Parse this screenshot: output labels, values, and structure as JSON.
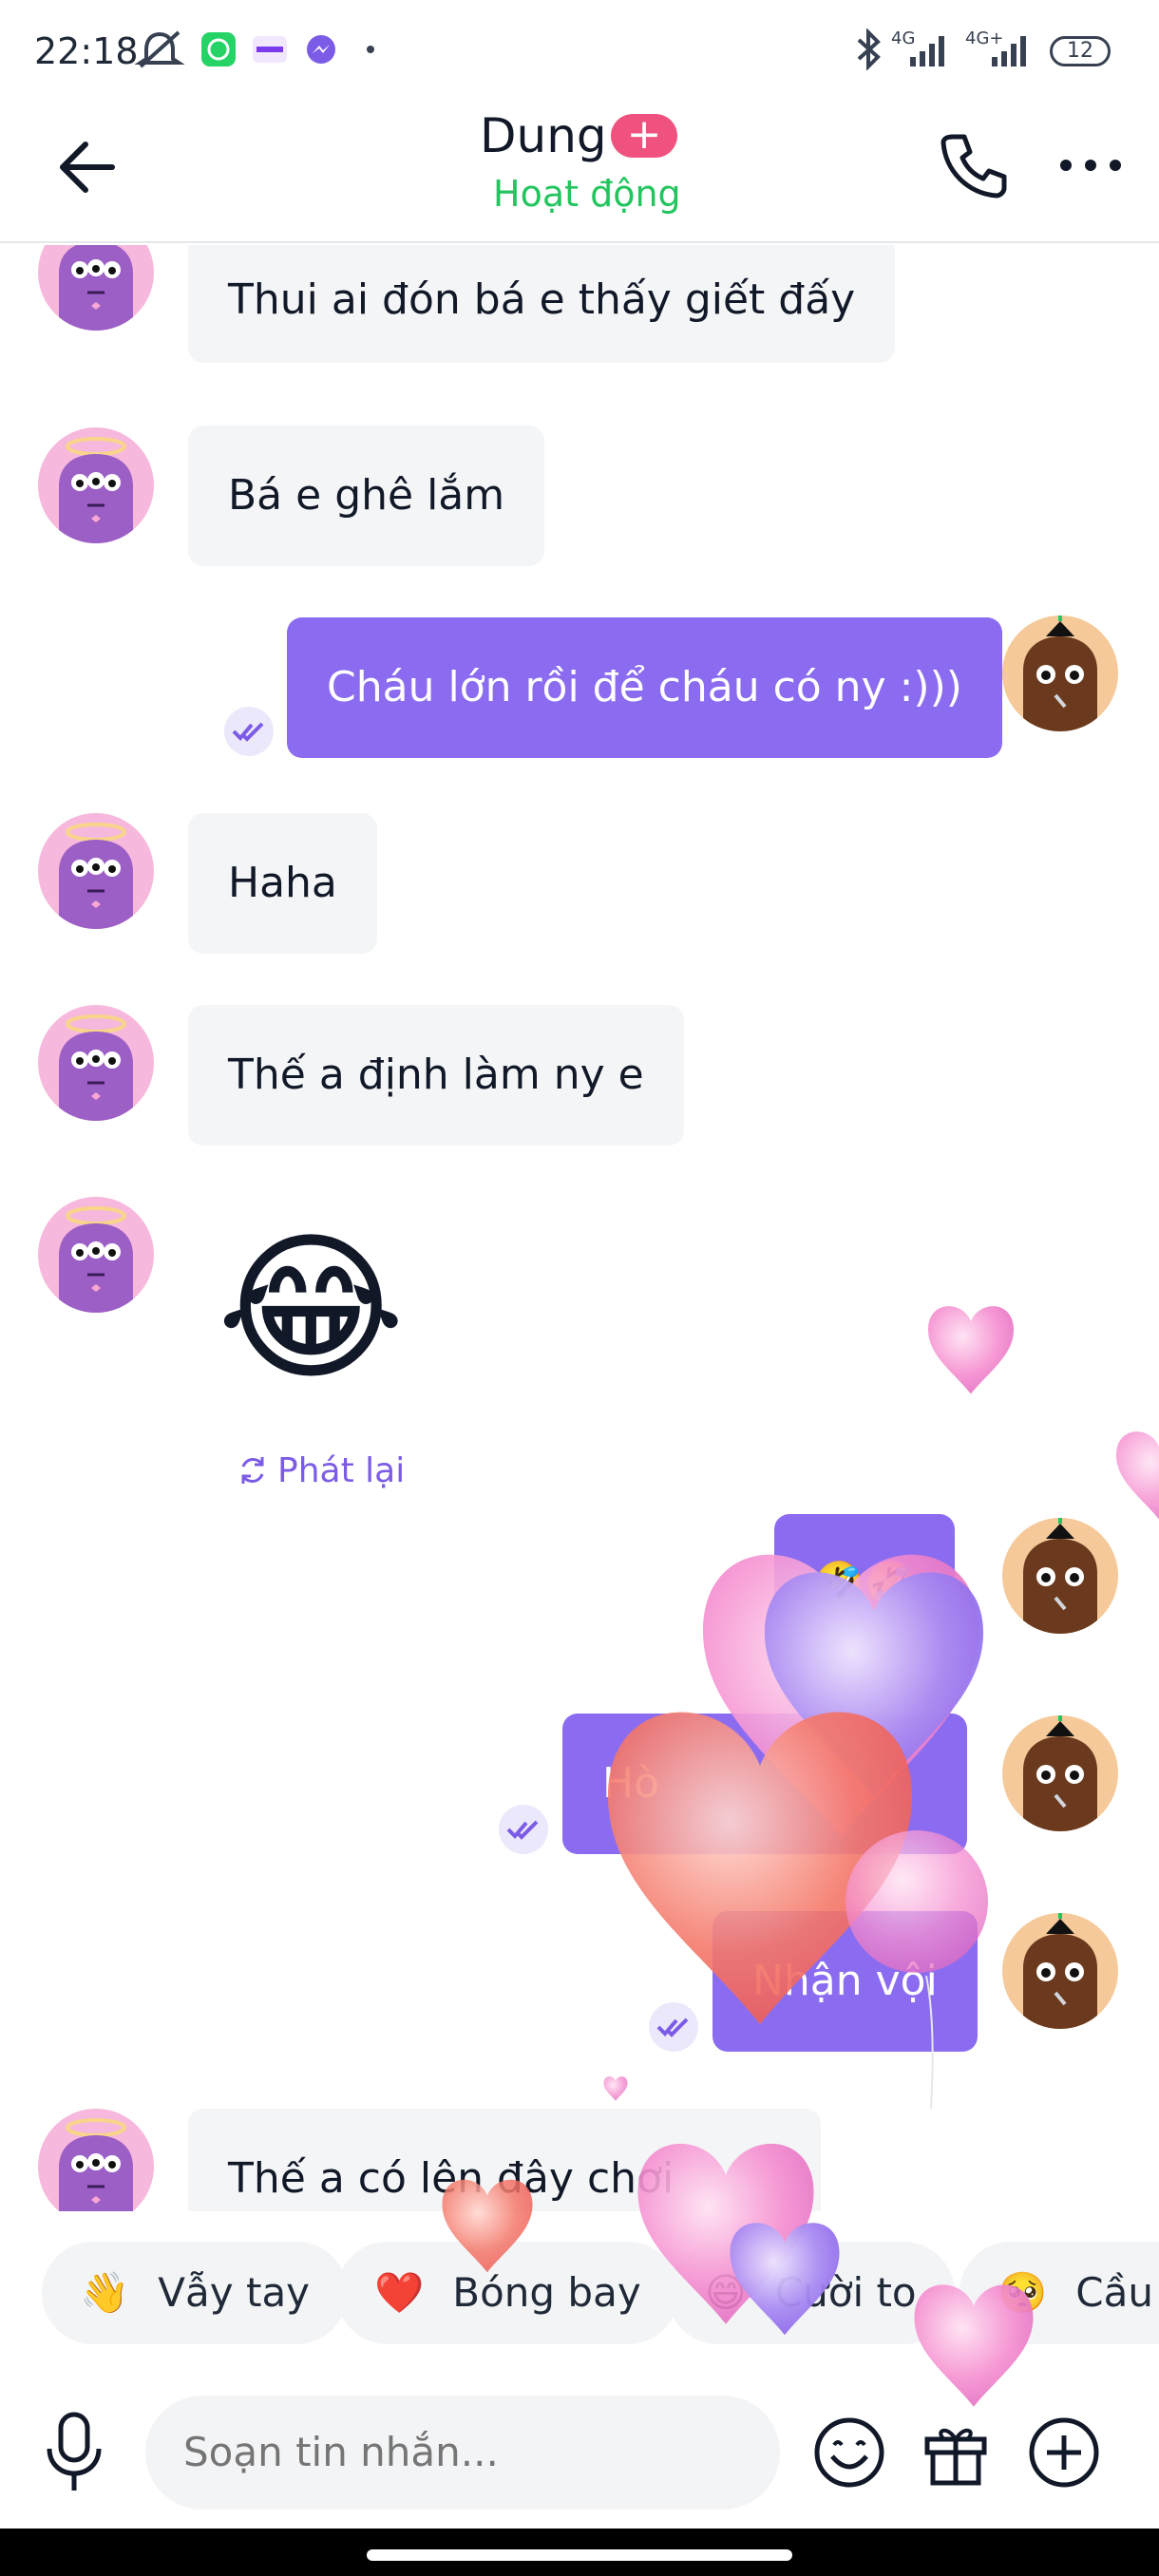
{
  "status_bar": {
    "time": "22:18",
    "signal_label_1": "4G",
    "signal_label_2": "4G+",
    "battery": "12"
  },
  "header": {
    "name": "Dung",
    "plus": "+",
    "status": "Hoạt động"
  },
  "messages": [
    {
      "text": "Thui ai đón bá e thấy giết đấy"
    },
    {
      "text": "Bá e ghê lắm"
    },
    {
      "text": "Cháu lớn rồi để cháu có ny :)))"
    },
    {
      "text": "Haha"
    },
    {
      "text": "Thế a định làm ny e"
    },
    {
      "text": "😂"
    },
    {
      "text": "🤣🤣"
    },
    {
      "text": "Hò"
    },
    {
      "text": "Nhận vội"
    },
    {
      "text": "Thế a có lên đây chơi"
    }
  ],
  "replay_label": "Phát lại",
  "quick_replies": [
    {
      "emoji": "👋",
      "label": "Vẫy tay"
    },
    {
      "emoji": "❤️",
      "label": "Bóng bay"
    },
    {
      "emoji": "😄",
      "label": "Cười to"
    },
    {
      "emoji": "🥺",
      "label": "Cầu xin"
    }
  ],
  "composer": {
    "placeholder": "Soạn tin nhắn..."
  },
  "colors": {
    "accent": "#8b6cf0",
    "online": "#22c55e",
    "badge": "#f0527f",
    "incoming_bubble": "#f4f5f7"
  },
  "icons": [
    "back-arrow-icon",
    "phone-icon",
    "more-icon",
    "read-receipt-icon",
    "replay-icon",
    "mic-icon",
    "emoji-icon",
    "gift-icon",
    "add-icon",
    "heart-icon"
  ]
}
